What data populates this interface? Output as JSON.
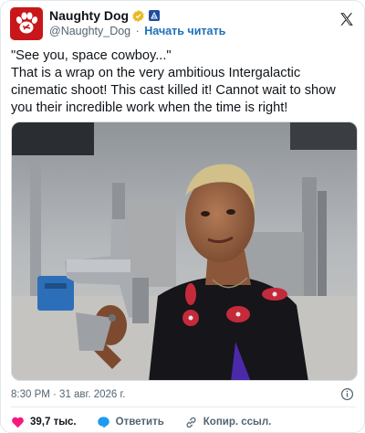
{
  "author": {
    "name": "Naughty Dog",
    "handle": "@Naughty_Dog",
    "separator": "·",
    "follow_label": "Начать читать"
  },
  "tweet": {
    "lines": [
      "\"See you, space cowboy...\"",
      "That is a wrap on the very ambitious Intergalactic",
      "cinematic shoot! This cast killed it! Cannot wait to show",
      "you their incredible work when the time is right!"
    ]
  },
  "timestamp": "8:30 PM · 31 авг. 2026 г.",
  "actions": {
    "likes": "39,7 тыс.",
    "reply_label": "Ответить",
    "copy_link_label": "Копир. ссыл."
  },
  "icons": {
    "avatar": "paw-logo-icon",
    "verified": "verified-badge-icon",
    "affiliate": "affiliate-badge-icon",
    "platform": "x-logo-icon",
    "info": "info-icon",
    "like": "heart-icon",
    "reply": "reply-bubble-icon",
    "copy": "link-icon"
  },
  "colors": {
    "avatar_bg": "#c8171b",
    "verified": "#e8b923",
    "follow": "#1d6fb8",
    "like": "#f91880",
    "reply": "#1d9bf0"
  }
}
